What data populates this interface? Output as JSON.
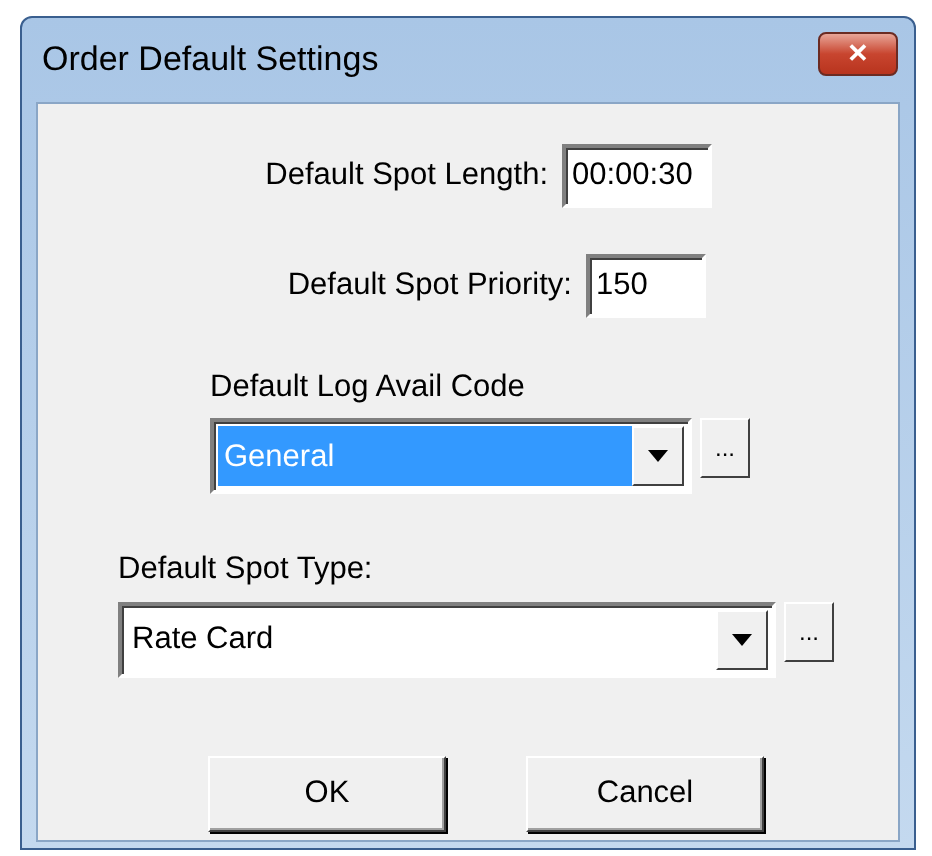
{
  "window": {
    "title": "Order Default Settings",
    "close": "✕"
  },
  "fields": [
    {
      "kind": "text",
      "label": "Default Spot Length:",
      "value": "00:00:30"
    },
    {
      "kind": "text",
      "label": "Default Spot Priority:",
      "value": "150"
    },
    {
      "kind": "combo",
      "label": "Default Log Avail Code",
      "value": "General",
      "highlighted": true,
      "browse": "..."
    },
    {
      "kind": "combo",
      "label": "Default Spot Type:",
      "value": "Rate Card",
      "highlighted": false,
      "browse": "..."
    }
  ],
  "buttons": [
    "OK",
    "Cancel"
  ]
}
